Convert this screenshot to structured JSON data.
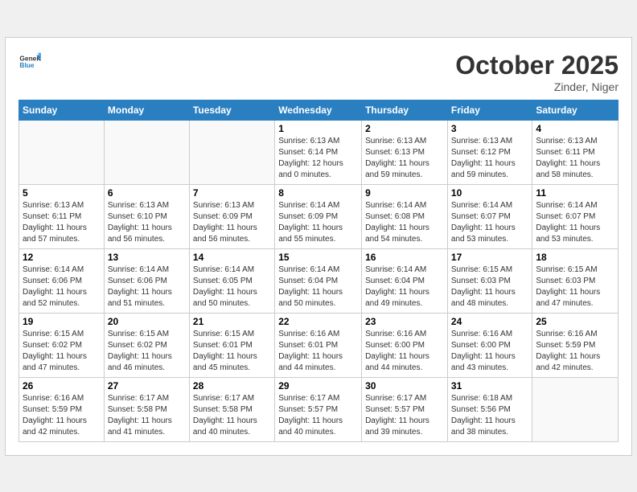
{
  "header": {
    "logo_general": "General",
    "logo_blue": "Blue",
    "month_title": "October 2025",
    "location": "Zinder, Niger"
  },
  "weekdays": [
    "Sunday",
    "Monday",
    "Tuesday",
    "Wednesday",
    "Thursday",
    "Friday",
    "Saturday"
  ],
  "weeks": [
    [
      {
        "day": "",
        "info": ""
      },
      {
        "day": "",
        "info": ""
      },
      {
        "day": "",
        "info": ""
      },
      {
        "day": "1",
        "info": "Sunrise: 6:13 AM\nSunset: 6:14 PM\nDaylight: 12 hours\nand 0 minutes."
      },
      {
        "day": "2",
        "info": "Sunrise: 6:13 AM\nSunset: 6:13 PM\nDaylight: 11 hours\nand 59 minutes."
      },
      {
        "day": "3",
        "info": "Sunrise: 6:13 AM\nSunset: 6:12 PM\nDaylight: 11 hours\nand 59 minutes."
      },
      {
        "day": "4",
        "info": "Sunrise: 6:13 AM\nSunset: 6:11 PM\nDaylight: 11 hours\nand 58 minutes."
      }
    ],
    [
      {
        "day": "5",
        "info": "Sunrise: 6:13 AM\nSunset: 6:11 PM\nDaylight: 11 hours\nand 57 minutes."
      },
      {
        "day": "6",
        "info": "Sunrise: 6:13 AM\nSunset: 6:10 PM\nDaylight: 11 hours\nand 56 minutes."
      },
      {
        "day": "7",
        "info": "Sunrise: 6:13 AM\nSunset: 6:09 PM\nDaylight: 11 hours\nand 56 minutes."
      },
      {
        "day": "8",
        "info": "Sunrise: 6:14 AM\nSunset: 6:09 PM\nDaylight: 11 hours\nand 55 minutes."
      },
      {
        "day": "9",
        "info": "Sunrise: 6:14 AM\nSunset: 6:08 PM\nDaylight: 11 hours\nand 54 minutes."
      },
      {
        "day": "10",
        "info": "Sunrise: 6:14 AM\nSunset: 6:07 PM\nDaylight: 11 hours\nand 53 minutes."
      },
      {
        "day": "11",
        "info": "Sunrise: 6:14 AM\nSunset: 6:07 PM\nDaylight: 11 hours\nand 53 minutes."
      }
    ],
    [
      {
        "day": "12",
        "info": "Sunrise: 6:14 AM\nSunset: 6:06 PM\nDaylight: 11 hours\nand 52 minutes."
      },
      {
        "day": "13",
        "info": "Sunrise: 6:14 AM\nSunset: 6:06 PM\nDaylight: 11 hours\nand 51 minutes."
      },
      {
        "day": "14",
        "info": "Sunrise: 6:14 AM\nSunset: 6:05 PM\nDaylight: 11 hours\nand 50 minutes."
      },
      {
        "day": "15",
        "info": "Sunrise: 6:14 AM\nSunset: 6:04 PM\nDaylight: 11 hours\nand 50 minutes."
      },
      {
        "day": "16",
        "info": "Sunrise: 6:14 AM\nSunset: 6:04 PM\nDaylight: 11 hours\nand 49 minutes."
      },
      {
        "day": "17",
        "info": "Sunrise: 6:15 AM\nSunset: 6:03 PM\nDaylight: 11 hours\nand 48 minutes."
      },
      {
        "day": "18",
        "info": "Sunrise: 6:15 AM\nSunset: 6:03 PM\nDaylight: 11 hours\nand 47 minutes."
      }
    ],
    [
      {
        "day": "19",
        "info": "Sunrise: 6:15 AM\nSunset: 6:02 PM\nDaylight: 11 hours\nand 47 minutes."
      },
      {
        "day": "20",
        "info": "Sunrise: 6:15 AM\nSunset: 6:02 PM\nDaylight: 11 hours\nand 46 minutes."
      },
      {
        "day": "21",
        "info": "Sunrise: 6:15 AM\nSunset: 6:01 PM\nDaylight: 11 hours\nand 45 minutes."
      },
      {
        "day": "22",
        "info": "Sunrise: 6:16 AM\nSunset: 6:01 PM\nDaylight: 11 hours\nand 44 minutes."
      },
      {
        "day": "23",
        "info": "Sunrise: 6:16 AM\nSunset: 6:00 PM\nDaylight: 11 hours\nand 44 minutes."
      },
      {
        "day": "24",
        "info": "Sunrise: 6:16 AM\nSunset: 6:00 PM\nDaylight: 11 hours\nand 43 minutes."
      },
      {
        "day": "25",
        "info": "Sunrise: 6:16 AM\nSunset: 5:59 PM\nDaylight: 11 hours\nand 42 minutes."
      }
    ],
    [
      {
        "day": "26",
        "info": "Sunrise: 6:16 AM\nSunset: 5:59 PM\nDaylight: 11 hours\nand 42 minutes."
      },
      {
        "day": "27",
        "info": "Sunrise: 6:17 AM\nSunset: 5:58 PM\nDaylight: 11 hours\nand 41 minutes."
      },
      {
        "day": "28",
        "info": "Sunrise: 6:17 AM\nSunset: 5:58 PM\nDaylight: 11 hours\nand 40 minutes."
      },
      {
        "day": "29",
        "info": "Sunrise: 6:17 AM\nSunset: 5:57 PM\nDaylight: 11 hours\nand 40 minutes."
      },
      {
        "day": "30",
        "info": "Sunrise: 6:17 AM\nSunset: 5:57 PM\nDaylight: 11 hours\nand 39 minutes."
      },
      {
        "day": "31",
        "info": "Sunrise: 6:18 AM\nSunset: 5:56 PM\nDaylight: 11 hours\nand 38 minutes."
      },
      {
        "day": "",
        "info": ""
      }
    ]
  ]
}
